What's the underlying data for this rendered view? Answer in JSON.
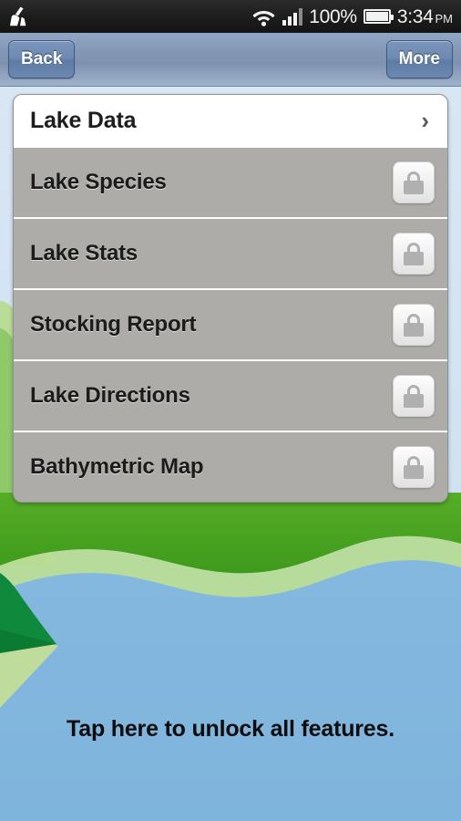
{
  "statusbar": {
    "app_icon": "broom-icon",
    "wifi_icon": "wifi-icon",
    "signal_icon": "cellular-signal-icon",
    "battery_percent": "100%",
    "battery_icon": "battery-full-icon",
    "time": "3:34",
    "ampm": "PM"
  },
  "navbar": {
    "back_label": "Back",
    "more_label": "More"
  },
  "card": {
    "header": {
      "title": "Lake Data",
      "chevron": "›"
    },
    "rows": [
      {
        "label": "Lake Species",
        "icon": "lock-icon",
        "locked": true
      },
      {
        "label": "Lake Stats",
        "icon": "lock-icon",
        "locked": true
      },
      {
        "label": "Stocking Report",
        "icon": "lock-icon",
        "locked": true
      },
      {
        "label": "Lake Directions",
        "icon": "lock-icon",
        "locked": true
      },
      {
        "label": "Bathymetric Map",
        "icon": "lock-icon",
        "locked": true
      }
    ]
  },
  "footer": {
    "unlock_text": "Tap here to unlock all features."
  },
  "colors": {
    "water": "#7fb4dc",
    "sky": "#d6e4f2",
    "grass": "#4da524",
    "grass_light": "#aed48a",
    "grass_dark": "#0f8a3c",
    "row_bg": "#adaca8",
    "nav_blue": "#8296b4",
    "button_blue": "#6f8bb2",
    "statusbar_bg": "#1c1c1c"
  }
}
